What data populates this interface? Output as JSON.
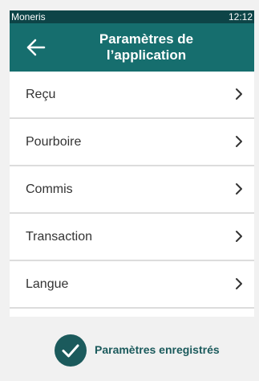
{
  "status_bar": {
    "carrier": "Moneris",
    "time": "12:12"
  },
  "header": {
    "title_line1": "Paramètres de",
    "title_line2": "l’application",
    "back_icon": "arrow-left-icon"
  },
  "menu": {
    "items": [
      {
        "label": "Reçu"
      },
      {
        "label": "Pourboire"
      },
      {
        "label": "Commis"
      },
      {
        "label": "Transaction"
      },
      {
        "label": "Langue"
      }
    ],
    "chevron_icon": "chevron-right-icon"
  },
  "footer": {
    "status_text": "Paramètres enregistrés",
    "status_icon": "check-circle-icon"
  },
  "colors": {
    "status_bar": "#0d4447",
    "app_bar": "#166e6e",
    "check_circle": "#1b5a5c"
  }
}
